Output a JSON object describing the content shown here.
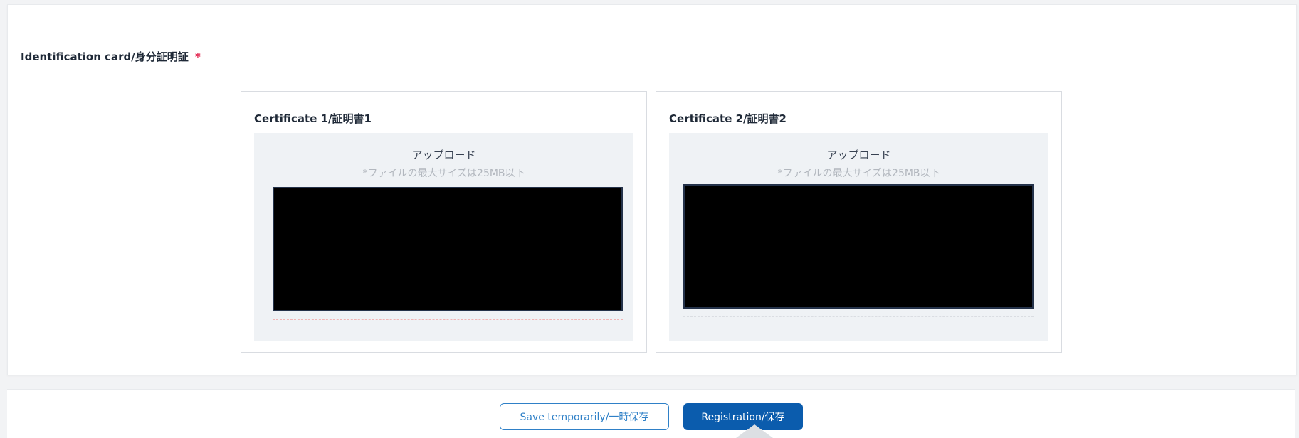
{
  "section": {
    "label": "Identification card/身分証明証",
    "required_marker": "*"
  },
  "certificates": [
    {
      "title": "Certificate 1/証明書1",
      "upload_title": "アップロード",
      "upload_hint": "*ファイルの最大サイズは25MB以下"
    },
    {
      "title": "Certificate 2/証明書2",
      "upload_title": "アップロード",
      "upload_hint": "*ファイルの最大サイズは25MB以下"
    }
  ],
  "footer": {
    "save_temp_label": "Save temporarily/一時保存",
    "register_label": "Registration/保存"
  },
  "colors": {
    "accent": "#0b5cad",
    "outline_button": "#2f80c7",
    "required": "#e11d48",
    "upload_bg": "#eff2f5"
  }
}
